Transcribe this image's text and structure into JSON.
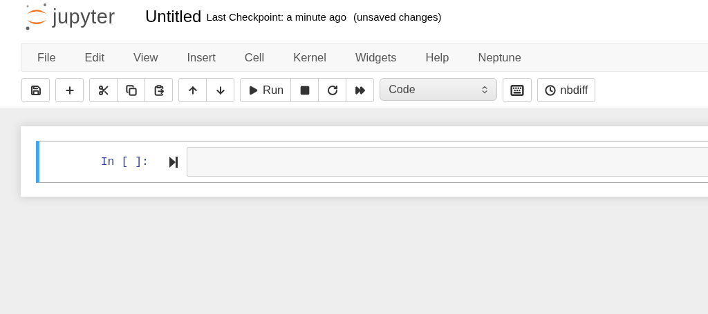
{
  "header": {
    "logo_text": "jupyter",
    "notebook_name": "Untitled",
    "checkpoint": "Last Checkpoint: a minute ago",
    "autosave_status": "(unsaved changes)"
  },
  "menubar": {
    "items": [
      "File",
      "Edit",
      "View",
      "Insert",
      "Cell",
      "Kernel",
      "Widgets",
      "Help",
      "Neptune"
    ]
  },
  "toolbar": {
    "groups": [
      [
        {
          "kind": "save"
        }
      ],
      [
        {
          "kind": "add"
        }
      ],
      [
        {
          "kind": "cut"
        },
        {
          "kind": "copy"
        },
        {
          "kind": "paste"
        }
      ],
      [
        {
          "kind": "up"
        },
        {
          "kind": "down"
        }
      ],
      [
        {
          "kind": "run",
          "label": "Run"
        },
        {
          "kind": "stop"
        },
        {
          "kind": "restart"
        },
        {
          "kind": "fast_forward"
        }
      ],
      [
        {
          "kind": "select",
          "value": "Code"
        }
      ],
      [
        {
          "kind": "keyboard"
        }
      ],
      [
        {
          "kind": "nbdiff",
          "label": "nbdiff"
        }
      ]
    ]
  },
  "cells": [
    {
      "prompt": "In [ ]:",
      "selected": true
    }
  ]
}
